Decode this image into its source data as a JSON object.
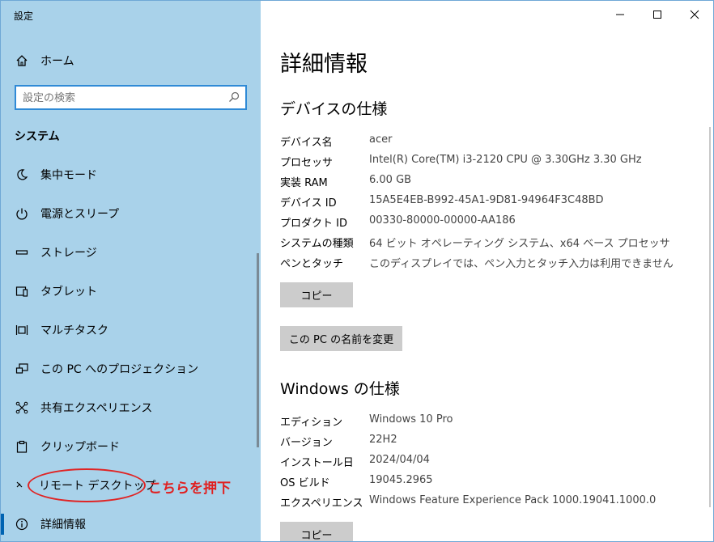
{
  "app": {
    "title": "設定"
  },
  "window_controls": {
    "minimize": "—",
    "maximize": "☐",
    "close": "✕"
  },
  "sidebar": {
    "home_label": "ホーム",
    "search": {
      "placeholder": "設定の検索",
      "value": ""
    },
    "section": "システム",
    "items": [
      {
        "label": "集中モード",
        "icon": "moon-icon"
      },
      {
        "label": "電源とスリープ",
        "icon": "power-icon"
      },
      {
        "label": "ストレージ",
        "icon": "storage-icon"
      },
      {
        "label": "タブレット",
        "icon": "tablet-icon"
      },
      {
        "label": "マルチタスク",
        "icon": "multitask-icon"
      },
      {
        "label": "この PC へのプロジェクション",
        "icon": "projection-icon"
      },
      {
        "label": "共有エクスペリエンス",
        "icon": "share-icon"
      },
      {
        "label": "クリップボード",
        "icon": "clipboard-icon"
      },
      {
        "label": "リモート デスクトップ",
        "icon": "remote-desktop-icon"
      },
      {
        "label": "詳細情報",
        "icon": "info-icon",
        "selected": true
      }
    ],
    "annotation": "こちらを押下",
    "annotation_color": "#e02020",
    "accent": "#0063b1",
    "background": "#a9d2ea"
  },
  "main": {
    "title": "詳細情報",
    "device_section": {
      "title": "デバイスの仕様",
      "rows": [
        {
          "key": "デバイス名",
          "value": "acer"
        },
        {
          "key": "プロセッサ",
          "value": "Intel(R) Core(TM) i3-2120 CPU @ 3.30GHz   3.30 GHz"
        },
        {
          "key": "実装 RAM",
          "value": "6.00 GB"
        },
        {
          "key": "デバイス ID",
          "value": "15A5E4EB-B992-45A1-9D81-94964F3C48BD"
        },
        {
          "key": "プロダクト ID",
          "value": "00330-80000-00000-AA186"
        },
        {
          "key": "システムの種類",
          "value": "64 ビット オペレーティング システム、x64 ベース プロセッサ"
        },
        {
          "key": "ペンとタッチ",
          "value": "このディスプレイでは、ペン入力とタッチ入力は利用できません"
        }
      ],
      "copy_button": "コピー",
      "rename_button": "この PC の名前を変更"
    },
    "windows_section": {
      "title": "Windows の仕様",
      "rows": [
        {
          "key": "エディション",
          "value": "Windows 10 Pro"
        },
        {
          "key": "バージョン",
          "value": "22H2"
        },
        {
          "key": "インストール日",
          "value": "2024/04/04"
        },
        {
          "key": "OS ビルド",
          "value": "19045.2965"
        },
        {
          "key": "エクスペリエンス",
          "value": "Windows Feature Experience Pack 1000.19041.1000.0"
        }
      ],
      "copy_button": "コピー"
    }
  }
}
